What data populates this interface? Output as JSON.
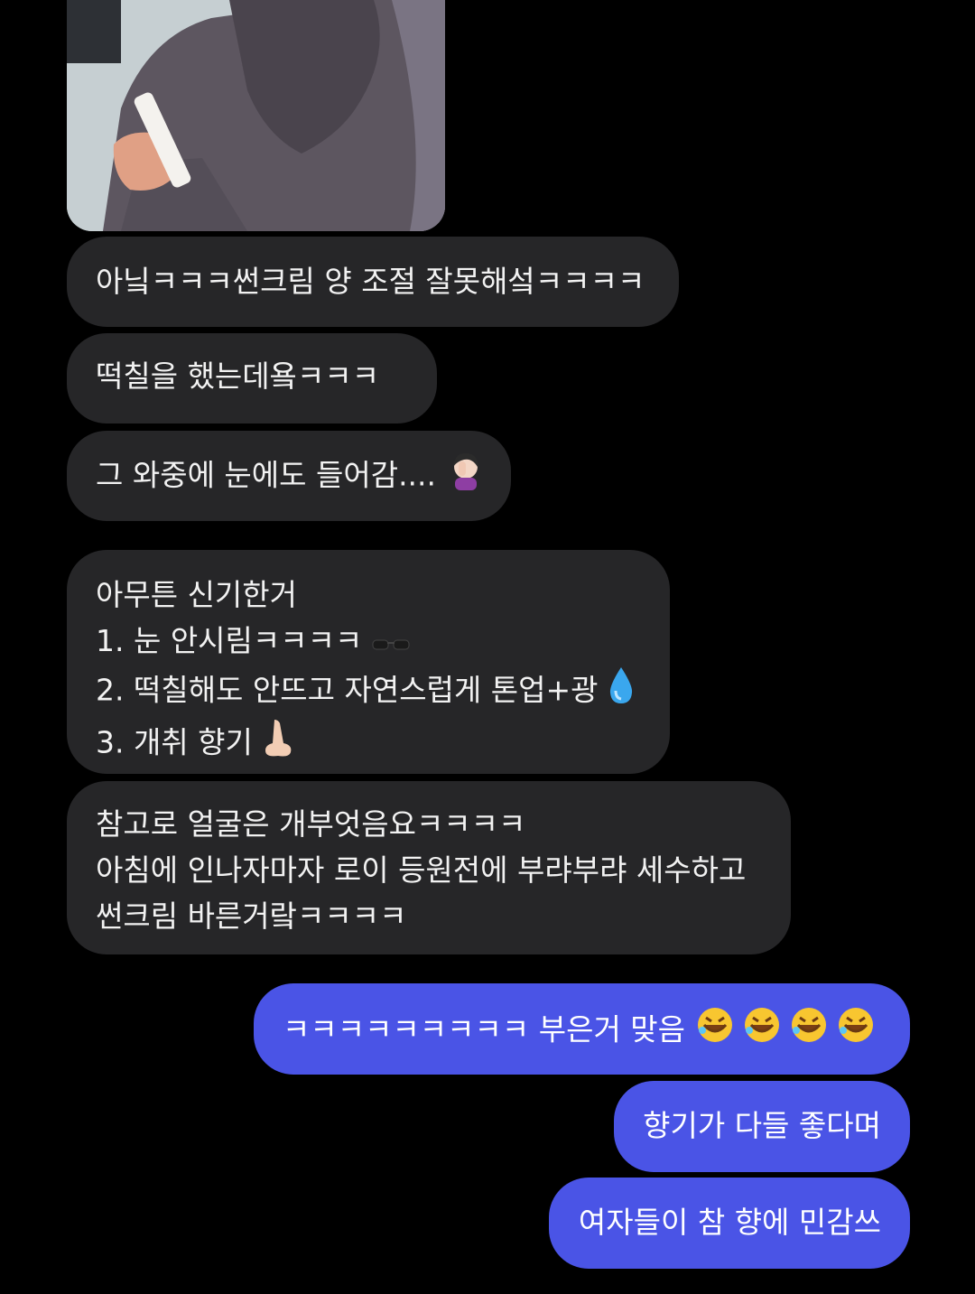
{
  "colors": {
    "background": "#000000",
    "incoming_bubble": "#262628",
    "outgoing_bubble": "#4a54e6",
    "text": "#ffffff"
  },
  "messages": {
    "incoming": [
      {
        "lines": [
          "아닠ㅋㅋㅋ썬크림 양 조절 잘못해섴ㅋㅋㅋㅋ"
        ]
      },
      {
        "lines": [
          "떡칠을 했는데욬ㅋㅋㅋ"
        ]
      },
      {
        "lines": [
          "그 와중에 눈에도 들어감...."
        ],
        "emoji": "woman-facepalming-emoji"
      },
      {
        "lines": [
          "아무튼 신기한거",
          "1. 눈 안시림ㅋㅋㅋㅋ",
          "2. 떡칠해도 안뜨고 자연스럽게 톤업+광",
          "3. 개취 향기"
        ],
        "emoji": [
          "sunglasses-emoji",
          "droplet-emoji",
          "nose-emoji"
        ]
      },
      {
        "lines": [
          "참고로 얼굴은 개부엇음요ㅋㅋㅋㅋ",
          "아침에 인나자마자 로이 등원전에 부랴부랴 세수하고",
          "썬크림 바른거랔ㅋㅋㅋㅋ"
        ]
      }
    ],
    "outgoing": [
      {
        "lines": [
          "ㅋㅋㅋㅋㅋㅋㅋㅋㅋ 부은거 맞음"
        ],
        "emoji": "rolling-laughing-emoji x4"
      },
      {
        "lines": [
          "향기가 다들 좋다며"
        ]
      },
      {
        "lines": [
          "여자들이 참 향에 민감쓰"
        ]
      }
    ]
  }
}
